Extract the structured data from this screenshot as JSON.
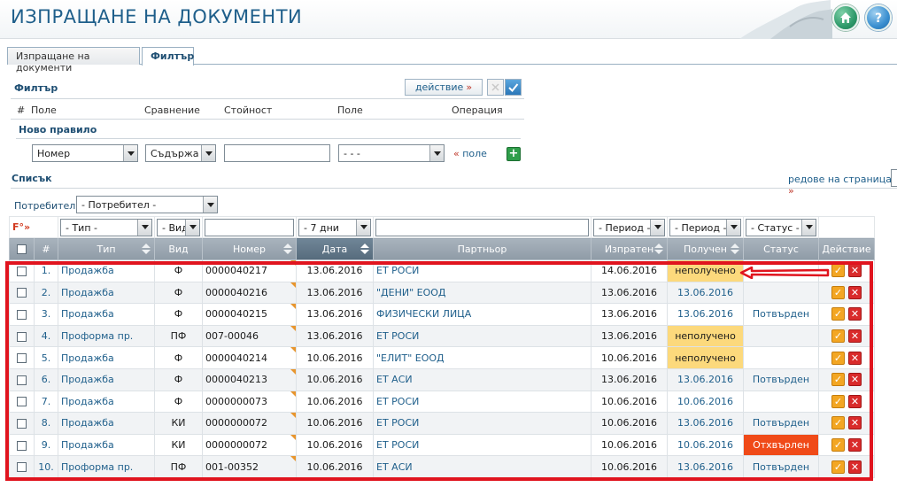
{
  "header": {
    "title": "ИЗПРАЩАНЕ НА ДОКУМЕНТИ",
    "home_icon": "home-icon",
    "help_icon": "help-icon"
  },
  "tabs": [
    {
      "label": "Изпращане на документи"
    },
    {
      "label": "Филтър"
    }
  ],
  "filter": {
    "title": "Филтър",
    "action_label": "действие",
    "action_arrows": "»",
    "columns": {
      "hash": "#",
      "field": "Поле",
      "comparison": "Сравнение",
      "value": "Стойност",
      "field2": "Поле",
      "operation": "Операция"
    },
    "new_rule": "Ново правило",
    "rule": {
      "field": "Номер",
      "comparison": "Съдържа",
      "value": "",
      "field2": "- - -",
      "add_link_arrows": "«",
      "add_link": "поле"
    }
  },
  "list": {
    "title": "Списък",
    "rows_per_page_label": "редове на страница",
    "rows_per_page_arrows": "»",
    "user_label": "Потребител",
    "user_select": "- Потребител -"
  },
  "table": {
    "filter_row": {
      "fx": "F°»",
      "type": "- Тип -",
      "kind": "- Вид",
      "date": "- 7 дни",
      "sent": "- Период -",
      "received": "- Период -",
      "status": "- Статус -"
    },
    "headers": [
      "#",
      "Тип",
      "Вид",
      "Номер",
      "Дата",
      "Партньор",
      "Изпратен",
      "Получен",
      "Статус",
      "Действие"
    ],
    "rows": [
      {
        "n": "1.",
        "type": "Продажба",
        "kind": "Ф",
        "number": "0000040217",
        "date": "13.06.2016",
        "partner": "ЕТ РОСИ",
        "sent": "14.06.2016",
        "received": "неполучено",
        "received_style": "yellow",
        "status": "",
        "status_style": ""
      },
      {
        "n": "2.",
        "type": "Продажба",
        "kind": "Ф",
        "number": "0000040216",
        "date": "13.06.2016",
        "partner": "\"ДЕНИ\" ЕООД",
        "sent": "13.06.2016",
        "received": "13.06.2016",
        "received_style": "",
        "status": "",
        "status_style": ""
      },
      {
        "n": "3.",
        "type": "Продажба",
        "kind": "Ф",
        "number": "0000040215",
        "date": "13.06.2016",
        "partner": "ФИЗИЧЕСКИ ЛИЦА",
        "sent": "13.06.2016",
        "received": "13.06.2016",
        "received_style": "",
        "status": "Потвърден",
        "status_style": ""
      },
      {
        "n": "4.",
        "type": "Проформа пр.",
        "kind": "ПФ",
        "number": "007-00046",
        "date": "13.06.2016",
        "partner": "ЕТ РОСИ",
        "sent": "13.06.2016",
        "received": "неполучено",
        "received_style": "yellow",
        "status": "",
        "status_style": ""
      },
      {
        "n": "5.",
        "type": "Продажба",
        "kind": "Ф",
        "number": "0000040214",
        "date": "10.06.2016",
        "partner": "\"ЕЛИТ\" ЕООД",
        "sent": "10.06.2016",
        "received": "неполучено",
        "received_style": "yellow",
        "status": "",
        "status_style": ""
      },
      {
        "n": "6.",
        "type": "Продажба",
        "kind": "Ф",
        "number": "0000040213",
        "date": "10.06.2016",
        "partner": "ЕТ АСИ",
        "sent": "13.06.2016",
        "received": "13.06.2016",
        "received_style": "",
        "status": "Потвърден",
        "status_style": ""
      },
      {
        "n": "7.",
        "type": "Продажба",
        "kind": "Ф",
        "number": "0000000073",
        "date": "10.06.2016",
        "partner": "ЕТ РОСИ",
        "sent": "10.06.2016",
        "received": "10.06.2016",
        "received_style": "",
        "status": "",
        "status_style": ""
      },
      {
        "n": "8.",
        "type": "Продажба",
        "kind": "КИ",
        "number": "0000000072",
        "date": "10.06.2016",
        "partner": "ЕТ РОСИ",
        "sent": "10.06.2016",
        "received": "13.06.2016",
        "received_style": "",
        "status": "Потвърден",
        "status_style": ""
      },
      {
        "n": "9.",
        "type": "Продажба",
        "kind": "КИ",
        "number": "0000000072",
        "date": "10.06.2016",
        "partner": "ЕТ РОСИ",
        "sent": "10.06.2016",
        "received": "10.06.2016",
        "received_style": "",
        "status": "Отхвърлен",
        "status_style": "red"
      },
      {
        "n": "10.",
        "type": "Проформа пр.",
        "kind": "ПФ",
        "number": "001-00352",
        "date": "10.06.2016",
        "partner": "ЕТ АСИ",
        "sent": "10.06.2016",
        "received": "13.06.2016",
        "received_style": "",
        "status": "Потвърден",
        "status_style": ""
      }
    ]
  },
  "colors": {
    "accent": "#1f5f8b",
    "header_row": "#99a5b0",
    "highlight_red": "#e0141e",
    "badge_yellow": "#fcd97c",
    "badge_red": "#f04a18"
  }
}
